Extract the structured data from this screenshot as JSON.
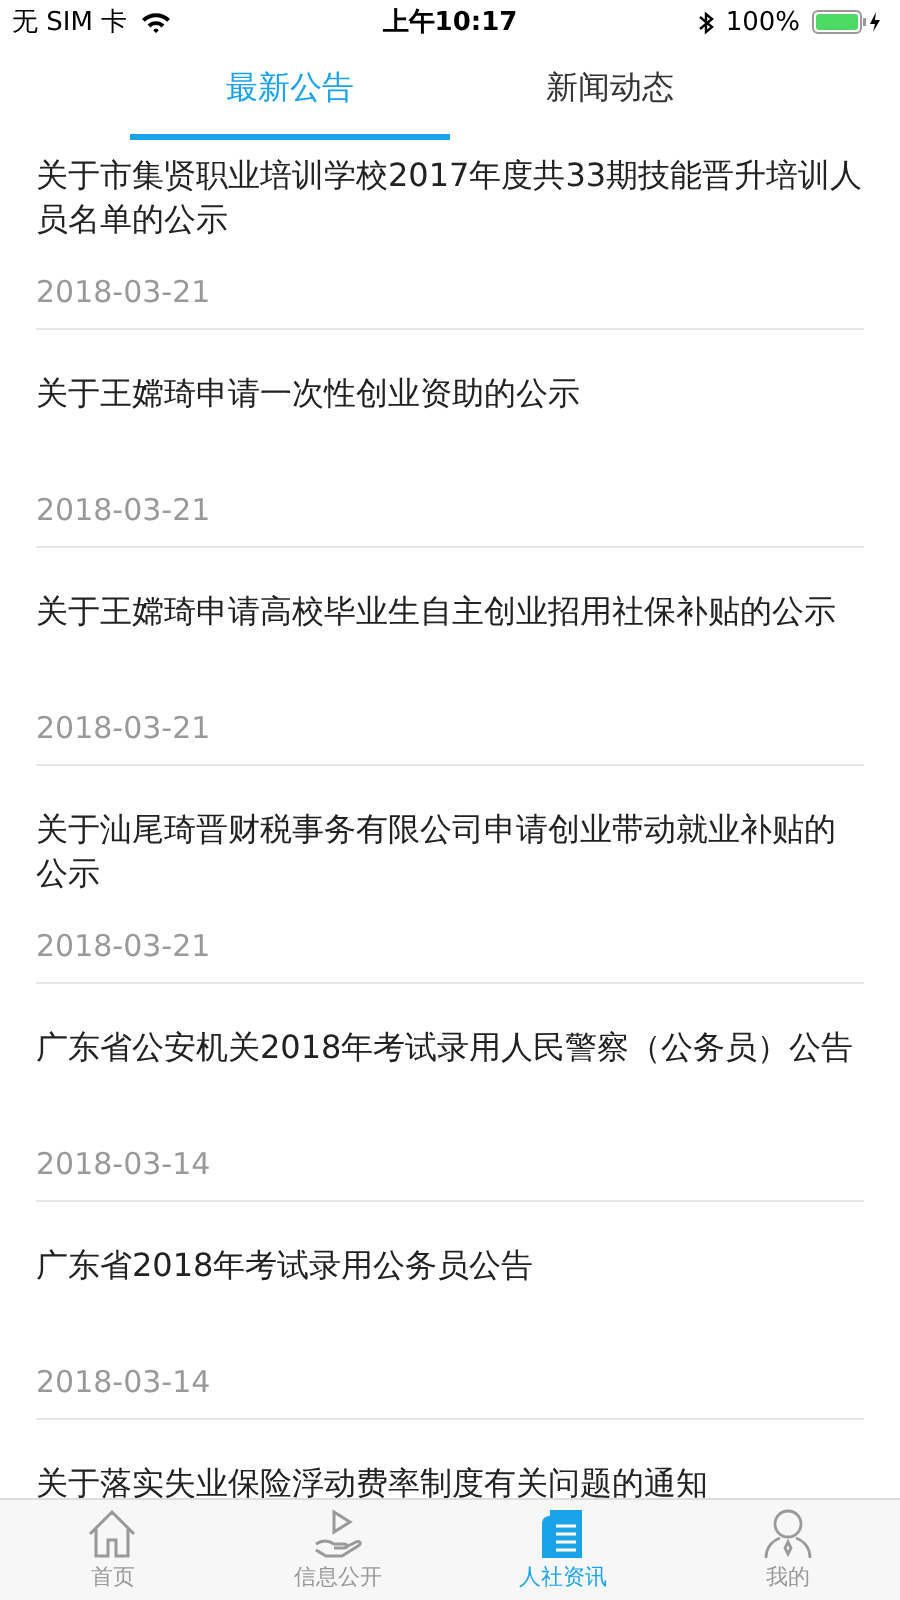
{
  "status_bar": {
    "carrier": "无 SIM 卡",
    "time": "上午10:17",
    "battery": "100%"
  },
  "tabs": [
    {
      "label": "最新公告",
      "selected": true
    },
    {
      "label": "新闻动态",
      "selected": false
    }
  ],
  "articles": [
    {
      "title": "关于市集贤职业培训学校2017年度共33期技能晋升培训人员名单的公示",
      "date": "2018-03-21"
    },
    {
      "title": "关于王嫦琦申请一次性创业资助的公示",
      "date": "2018-03-21"
    },
    {
      "title": "关于王嫦琦申请高校毕业生自主创业招用社保补贴的公示",
      "date": "2018-03-21"
    },
    {
      "title": "关于汕尾琦晋财税事务有限公司申请创业带动就业补贴的公示",
      "date": "2018-03-21"
    },
    {
      "title": "广东省公安机关2018年考试录用人民警察（公务员）公告",
      "date": "2018-03-14"
    },
    {
      "title": "广东省2018年考试录用公务员公告",
      "date": "2018-03-14"
    },
    {
      "title": "关于落实失业保险浮动费率制度有关问题的通知"
    }
  ],
  "tab_bar": [
    {
      "label": "首页",
      "kind": "home",
      "selected": false
    },
    {
      "label": "信息公开",
      "kind": "hand",
      "selected": false
    },
    {
      "label": "人社资讯",
      "kind": "doc",
      "selected": true
    },
    {
      "label": "我的",
      "kind": "person",
      "selected": false
    }
  ]
}
